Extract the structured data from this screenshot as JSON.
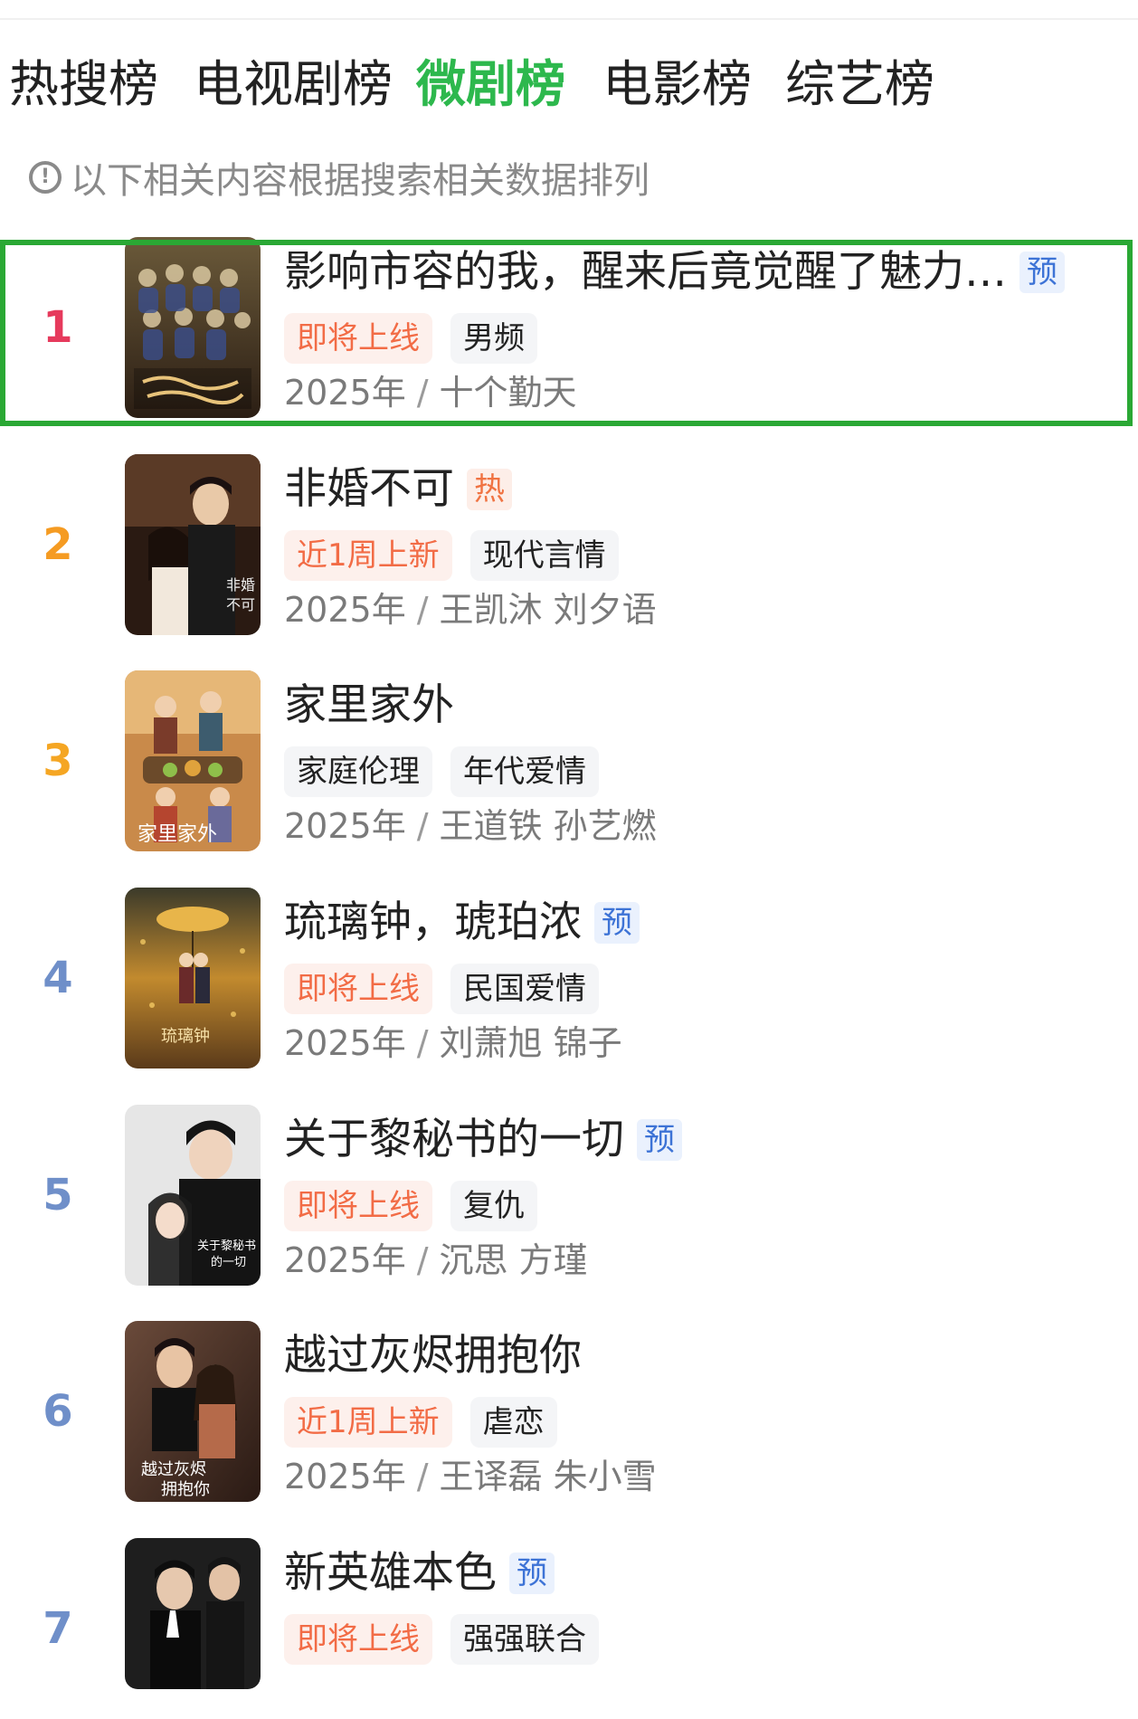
{
  "tabs": [
    {
      "label": "热搜榜",
      "active": false
    },
    {
      "label": "电视剧榜",
      "active": false
    },
    {
      "label": "微剧榜",
      "active": true
    },
    {
      "label": "电影榜",
      "active": false
    },
    {
      "label": "综艺榜",
      "active": false
    }
  ],
  "notice": {
    "icon": "info-icon",
    "text": "以下相关内容根据搜索相关数据排列"
  },
  "colors": {
    "active_tab": "#2db84d",
    "highlight_border": "#2aa834",
    "rank_1": "#e63a5c",
    "rank_2": "#f59b22",
    "rank_3": "#f5a623",
    "rank_other": "#6f8fc9",
    "tag_new_text": "#f26c46",
    "badge_pre_text": "#3d73d6"
  },
  "list": [
    {
      "rank": "1",
      "title": "影响市容的我，醒来后竟觉醒了魅力…",
      "badge": "预",
      "tags": [
        "即将上线",
        "男频"
      ],
      "year": "2025年",
      "sep": "/",
      "people": "十个勤天",
      "highlighted": true
    },
    {
      "rank": "2",
      "title": "非婚不可",
      "badge": "热",
      "tags": [
        "近1周上新",
        "现代言情"
      ],
      "year": "2025年",
      "sep": "/",
      "people": "王凯沐 刘夕语"
    },
    {
      "rank": "3",
      "title": "家里家外",
      "badge": "",
      "tags": [
        "家庭伦理",
        "年代爱情"
      ],
      "year": "2025年",
      "sep": "/",
      "people": "王道铁 孙艺燃"
    },
    {
      "rank": "4",
      "title": "琉璃钟，琥珀浓",
      "badge": "预",
      "tags": [
        "即将上线",
        "民国爱情"
      ],
      "year": "2025年",
      "sep": "/",
      "people": "刘萧旭 锦子"
    },
    {
      "rank": "5",
      "title": "关于黎秘书的一切",
      "badge": "预",
      "tags": [
        "即将上线",
        "复仇"
      ],
      "year": "2025年",
      "sep": "/",
      "people": "沉思 方瑾"
    },
    {
      "rank": "6",
      "title": "越过灰烬拥抱你",
      "badge": "",
      "tags": [
        "近1周上新",
        "虐恋"
      ],
      "year": "2025年",
      "sep": "/",
      "people": "王译磊 朱小雪"
    },
    {
      "rank": "7",
      "title": "新英雄本色",
      "badge": "预",
      "tags": [
        "即将上线",
        "强强联合"
      ],
      "year": "",
      "sep": "",
      "people": ""
    }
  ]
}
